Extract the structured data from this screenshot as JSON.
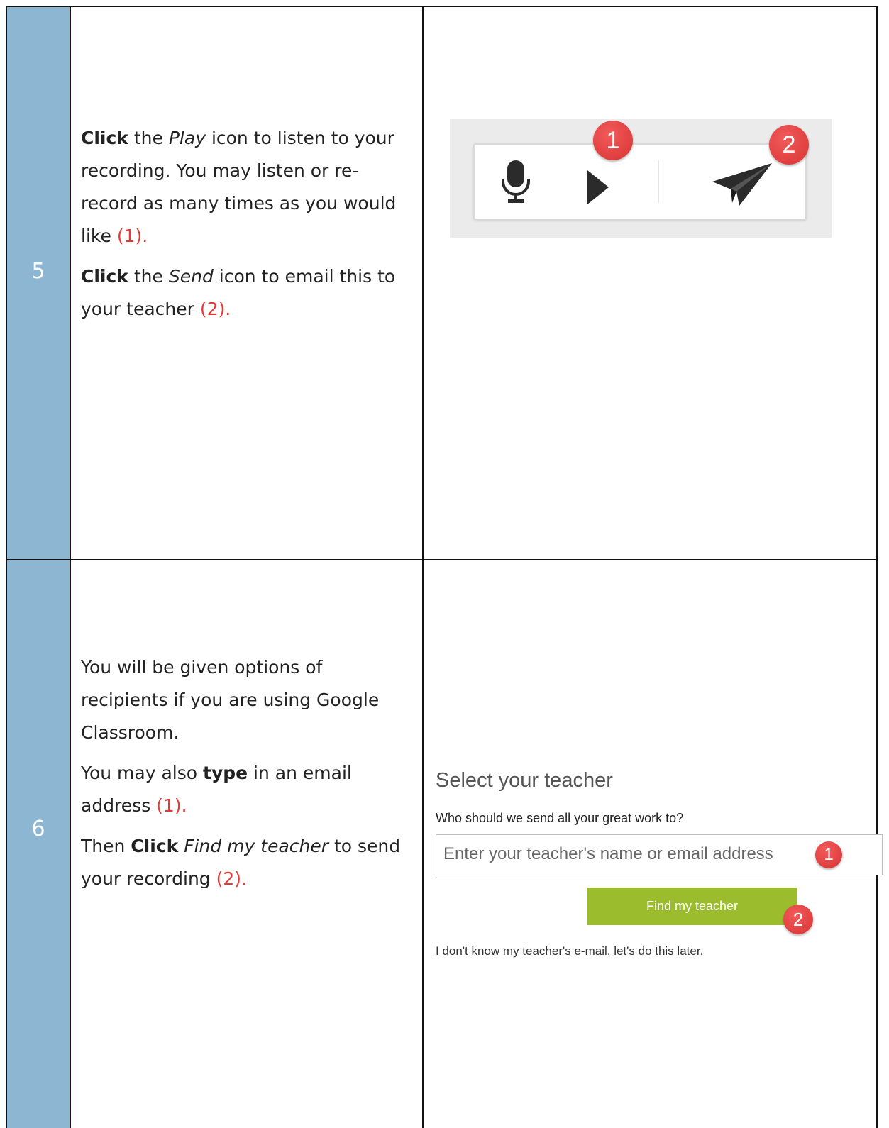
{
  "steps": [
    {
      "number": "5",
      "paragraphs": [
        [
          {
            "t": "Click",
            "s": "b"
          },
          {
            "t": " the ",
            "s": ""
          },
          {
            "t": "Play",
            "s": "i"
          },
          {
            "t": " icon to listen to your recording.  You may listen or re-record as many times as you would like ",
            "s": ""
          },
          {
            "t": "(1).",
            "s": "red"
          }
        ],
        [
          {
            "t": "Click",
            "s": "b"
          },
          {
            "t": " the ",
            "s": ""
          },
          {
            "t": "Send",
            "s": "i"
          },
          {
            "t": " icon to email this to your teacher ",
            "s": ""
          },
          {
            "t": "(2).",
            "s": "red"
          }
        ]
      ],
      "screenshot": {
        "icons": [
          "microphone-icon",
          "play-icon",
          "send-paper-plane-icon"
        ],
        "badges": [
          "1",
          "2"
        ],
        "badge_color": "#e03a3a"
      }
    },
    {
      "number": "6",
      "paragraphs": [
        [
          {
            "t": "You will be given options of recipients if you are using Google Classroom.",
            "s": ""
          }
        ],
        [
          {
            "t": "You may also ",
            "s": ""
          },
          {
            "t": "type",
            "s": "b"
          },
          {
            "t": " in an email address ",
            "s": ""
          },
          {
            "t": "(1).",
            "s": "red"
          }
        ],
        [
          {
            "t": "Then ",
            "s": ""
          },
          {
            "t": "Click",
            "s": "b"
          },
          {
            "t": " ",
            "s": ""
          },
          {
            "t": "Find my teacher",
            "s": "i"
          },
          {
            "t": " to send your recording ",
            "s": ""
          },
          {
            "t": "(2).",
            "s": "red"
          }
        ]
      ],
      "screenshot": {
        "title": "Select your teacher",
        "question": "Who should we send all your great work to?",
        "input_placeholder": "Enter your teacher's name or email address",
        "button_label": "Find my teacher",
        "later_link": "I don't know my teacher's e-mail, let's do this later.",
        "badges": [
          "1",
          "2"
        ],
        "button_color": "#9bbd2d"
      }
    }
  ],
  "colors": {
    "number_column": "#8db6d2",
    "annotation_red": "#e53935"
  }
}
